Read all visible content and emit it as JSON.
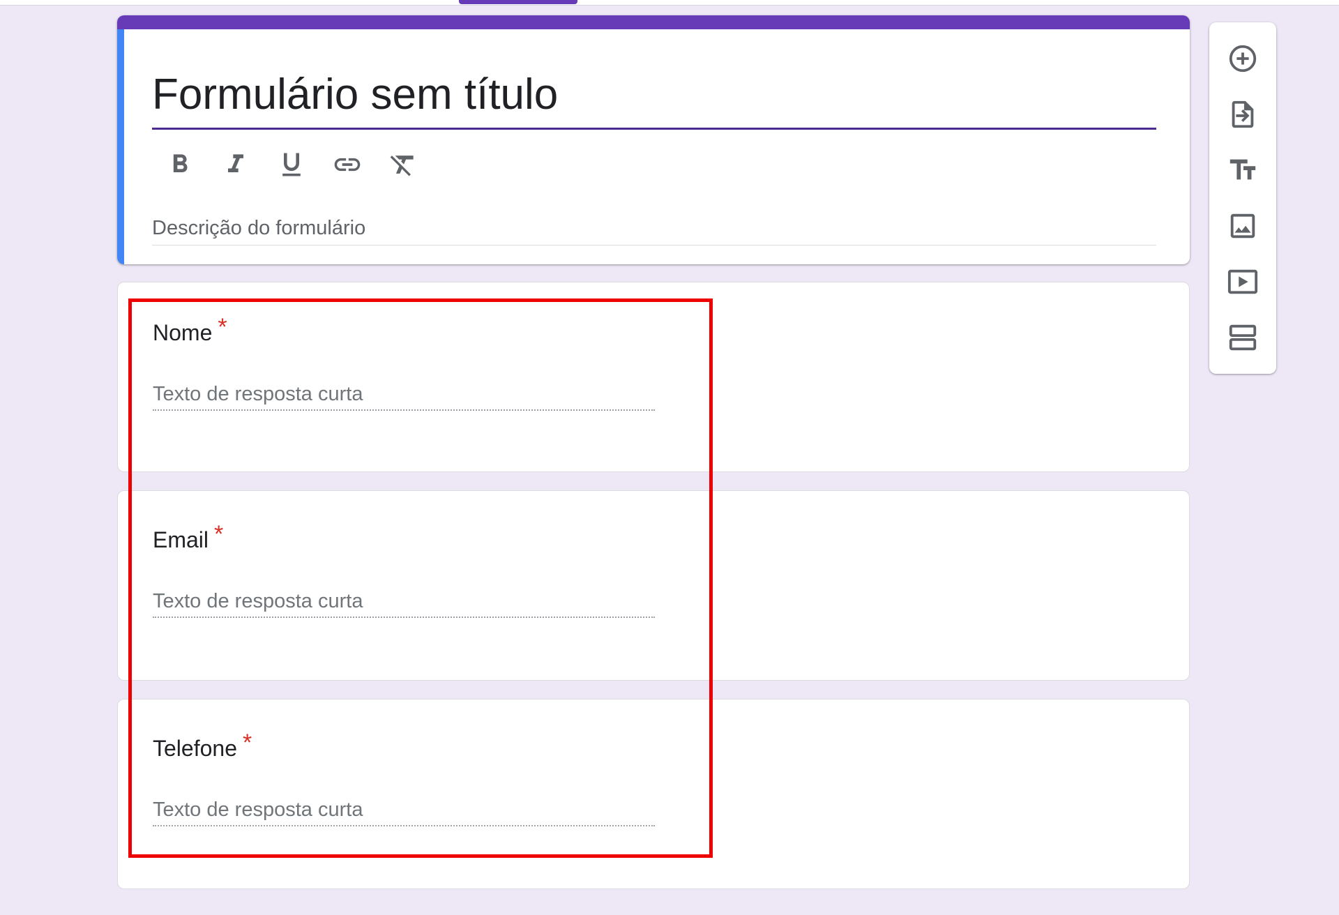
{
  "form": {
    "title": "Formulário sem título",
    "description_placeholder": "Descrição do formulário",
    "accent_color": "#673ab7",
    "side_accent_color": "#4285f4"
  },
  "text_toolbar": [
    {
      "name": "bold-icon"
    },
    {
      "name": "italic-icon"
    },
    {
      "name": "underline-icon"
    },
    {
      "name": "link-icon"
    },
    {
      "name": "clear-formatting-icon"
    }
  ],
  "questions": [
    {
      "label": "Nome",
      "required_marker": "*",
      "placeholder": "Texto de resposta curta"
    },
    {
      "label": "Email",
      "required_marker": "*",
      "placeholder": "Texto de resposta curta"
    },
    {
      "label": "Telefone",
      "required_marker": "*",
      "placeholder": "Texto de resposta curta"
    }
  ],
  "side_toolbar": [
    {
      "name": "add-question-icon"
    },
    {
      "name": "import-questions-icon"
    },
    {
      "name": "add-title-description-icon"
    },
    {
      "name": "add-image-icon"
    },
    {
      "name": "add-video-icon"
    },
    {
      "name": "add-section-icon"
    }
  ],
  "highlight": {
    "color": "#ee0000"
  }
}
